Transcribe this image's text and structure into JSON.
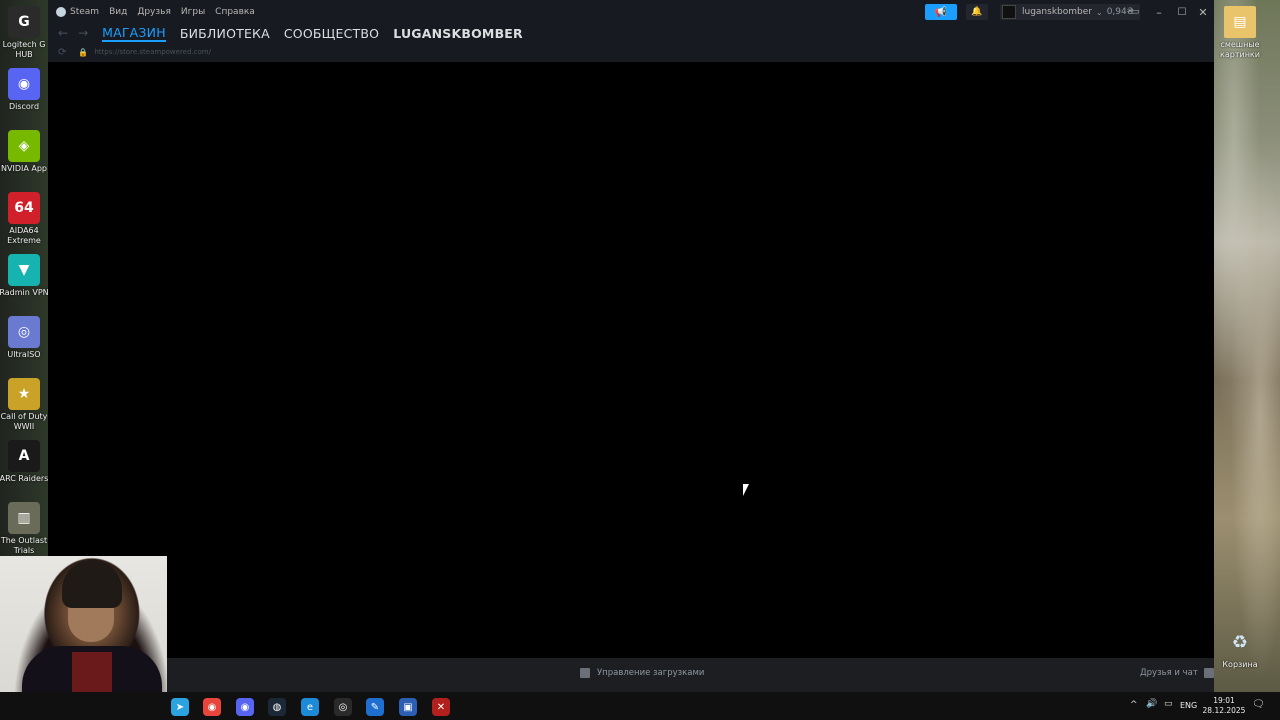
{
  "desktop": {
    "left_icons": [
      {
        "name": "logitech-g-hub-icon",
        "label": "Logitech G HUB",
        "color": "#2b2b2b",
        "glyph": "G"
      },
      {
        "name": "discord-icon",
        "label": "Discord",
        "color": "#5865f2",
        "glyph": "◉"
      },
      {
        "name": "nvidia-app-icon",
        "label": "NVIDIA App",
        "color": "#76b900",
        "glyph": "◈"
      },
      {
        "name": "aida64-icon",
        "label": "AIDA64 Extreme",
        "color": "#d0202a",
        "glyph": "64"
      },
      {
        "name": "radmin-vpn-icon",
        "label": "Radmin VPN",
        "color": "#17b3b0",
        "glyph": "▼"
      },
      {
        "name": "ultraiso-icon",
        "label": "UltraISO",
        "color": "#6a7ad0",
        "glyph": "◎"
      },
      {
        "name": "call-of-duty-icon",
        "label": "Call of Duty WWII",
        "color": "#c9a227",
        "glyph": "★"
      },
      {
        "name": "arc-raiders-icon",
        "label": "ARC Raiders",
        "color": "#1a1a1a",
        "glyph": "A"
      },
      {
        "name": "outlast-trials-icon",
        "label": "The Outlast Trials",
        "color": "#6b6b5a",
        "glyph": "▥"
      }
    ],
    "right_icons": [
      {
        "name": "funny-pictures-folder-icon",
        "label": "смешные картинки"
      },
      {
        "name": "recycle-bin-icon",
        "label": "Корзина"
      }
    ]
  },
  "steam": {
    "menu": [
      "Steam",
      "Вид",
      "Друзья",
      "Игры",
      "Справка"
    ],
    "account": "luganskbomber",
    "balance": "0,94₴",
    "tabs": [
      "МАГАЗИН",
      "БИБЛИОТЕКА",
      "СООБЩЕСТВО",
      "LUGANSKBOMBER"
    ],
    "url": "https://store.steampowered.com/",
    "downloads_label": "Управление загрузками",
    "friends_label": "Друзья и чат"
  },
  "taskbar": {
    "apps": [
      {
        "name": "telegram-taskbar-icon",
        "color": "#2aa3df",
        "glyph": "➤"
      },
      {
        "name": "chrome-taskbar-icon",
        "color": "#e8453c",
        "glyph": "◉"
      },
      {
        "name": "discord-taskbar-icon",
        "color": "#5865f2",
        "glyph": "◉"
      },
      {
        "name": "steam-taskbar-icon",
        "color": "#1b2838",
        "glyph": "◍"
      },
      {
        "name": "edge-taskbar-icon",
        "color": "#1d8ad8",
        "glyph": "e"
      },
      {
        "name": "obs-taskbar-icon",
        "color": "#2a2a2a",
        "glyph": "◎"
      },
      {
        "name": "paint-taskbar-icon",
        "color": "#1e6fd0",
        "glyph": "✎"
      },
      {
        "name": "window-taskbar-icon",
        "color": "#2c5fb3",
        "glyph": "▣"
      },
      {
        "name": "app-red-taskbar-icon",
        "color": "#b0201c",
        "glyph": "✕"
      }
    ],
    "language": "ENG",
    "time": "19:01",
    "date": "28.12.2025"
  }
}
